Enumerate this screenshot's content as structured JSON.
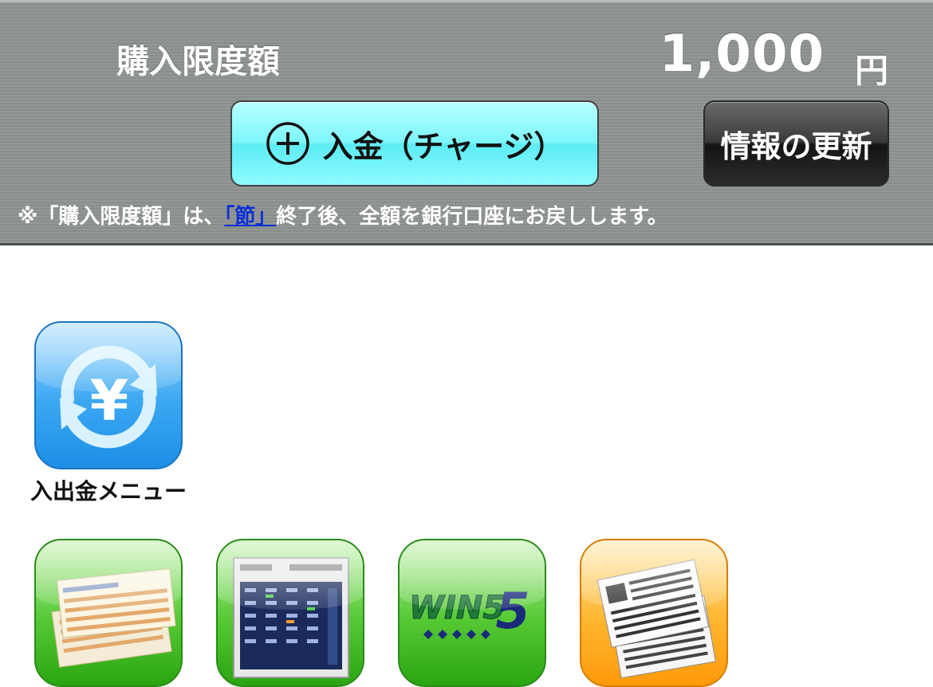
{
  "header": {
    "limit_label": "購入限度額",
    "limit_value": "1,000",
    "limit_unit": "円",
    "charge_button_label": "入金（チャージ）",
    "refresh_button_label": "情報の更新",
    "note_prefix": "※「購入限度額」は、",
    "note_link": "「節」",
    "note_suffix": "終了後、全額を銀行口座にお戻しします。"
  },
  "menu": {
    "deposit": {
      "label": "入出金メニュー",
      "icon": "yen-exchange-icon"
    },
    "row2": [
      {
        "icon": "betting-slip-icon"
      },
      {
        "icon": "odds-table-icon"
      },
      {
        "icon": "win5-icon",
        "logo_text": "WIN5"
      },
      {
        "icon": "race-card-icon"
      }
    ]
  },
  "colors": {
    "header_bg": "#8d938f",
    "charge_button": "#7ef6fb",
    "refresh_button": "#1e1e1e",
    "link": "#0b2fd6",
    "icon_blue": "#3aa7f2",
    "icon_green": "#55c934",
    "icon_orange": "#ffb630"
  }
}
